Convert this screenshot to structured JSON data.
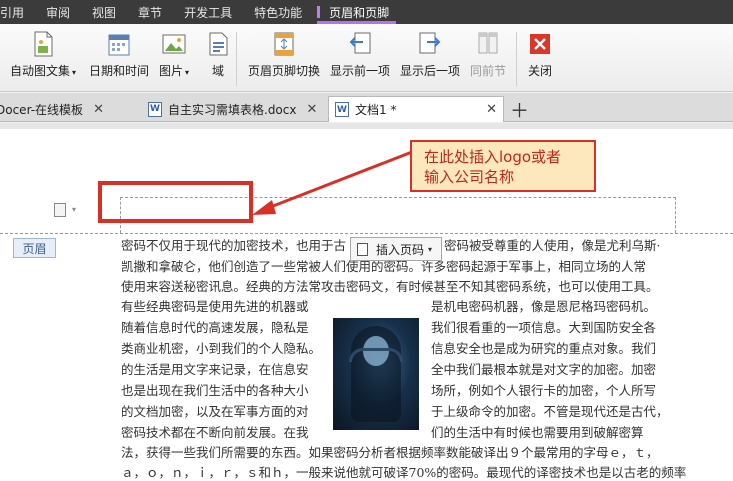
{
  "ribbon_tabs": [
    {
      "label": "引用",
      "active": false
    },
    {
      "label": "审阅",
      "active": false
    },
    {
      "label": "视图",
      "active": false
    },
    {
      "label": "章节",
      "active": false
    },
    {
      "label": "开发工具",
      "active": false
    },
    {
      "label": "特色功能",
      "active": false
    },
    {
      "label": "页眉和页脚",
      "active": true
    }
  ],
  "toolbar": {
    "auto_figure": "自动图文集",
    "date_time": "日期和时间",
    "picture": "图片",
    "field": "域",
    "switch_header_footer": "页眉页脚切换",
    "show_previous": "显示前一项",
    "show_next": "显示后一项",
    "same_section": "同前节",
    "close": "关闭"
  },
  "doc_tabs": [
    {
      "label": "Docer-在线模板",
      "active": false
    },
    {
      "label": "自主实习需填表格.docx",
      "active": false
    },
    {
      "label": "文档1 *",
      "active": true
    }
  ],
  "document": {
    "header_label": "页眉",
    "callout_line1": "在此处插入logo或者",
    "callout_line2": "输入公司名称",
    "insert_page_number": "插入页码",
    "body_lines": [
      "密码不仅用于现代的加密技术，也用于古",
      "密码被受尊重的人使用，像是尤利乌斯·",
      "凯撒和拿破仑，他们创造了一些常被人们使用的密码。许多密码起源于军事上，相同立场的人常",
      "使用来容送秘密讯息。经典的方法常攻击密码文，有时候甚至不知其密码系统，也可以使用工具。",
      "有些经典密码是使用先进的机器或",
      "是机电密码机器，像是恩尼格玛密码机。",
      "随着信息时代的高速发展，隐私是",
      "我们很看重的一项信息。大到国防安全各",
      "类商业机密，小到我们的个人隐私。",
      "信息安全也是成为研究的重点对象。我们",
      "的生活是用文字来记录，在信息安",
      "全中我们最根本就是对文字的加密。加密",
      "也是出现在我们生活中的各种大小",
      "场所，例如个人银行卡的加密，个人所写",
      "的文档加密，以及在军事方面的对",
      "于上级命令的加密。不管是现代还是古代，",
      "密码技术都在不断向前发展。在我",
      "们的生活中有时候也需要用到破解密算",
      "法，获得一些我们所需要的东西。如果密码分析者根据频率数能破译出９个最常用的字母ｅ，ｔ，",
      "ａ，ｏ，ｎ，ｉ，ｒ，ｓ和ｈ，一般来说他就可破译70%的密码。最现代的译密技术也是以古老的频率"
    ]
  },
  "colors": {
    "ribbon_tab_bar": "#3b3b3b",
    "active_tab_accent": "#b86ff0",
    "highlight_red": "#d93025",
    "callout_fill": "#fde7bd",
    "close_icon_red": "#d9372a"
  }
}
